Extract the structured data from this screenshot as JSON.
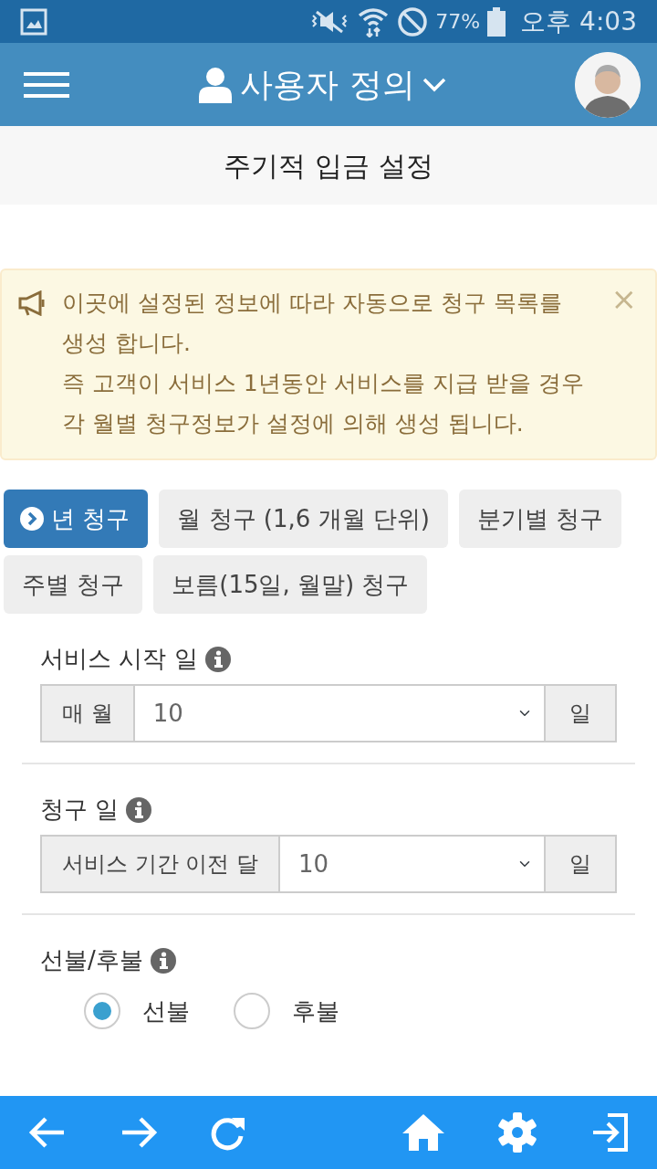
{
  "status_bar": {
    "battery": "77%",
    "time": "오후 4:03"
  },
  "header": {
    "title": "사용자 정의"
  },
  "page_title": "주기적 입금 설정",
  "alert": {
    "paragraphs": [
      "이곳에 설정된 정보에 따라 자동으로 청구 목록를 생성 합니다.",
      "즉 고객이 서비스 1년동안 서비스를 지급 받을 경우 각 월별 청구정보가 설정에 의해 생성 됩니다."
    ],
    "close": "×"
  },
  "tabs": [
    {
      "label": "년 청구",
      "selected": true
    },
    {
      "label": "월 청구 (1,6 개월 단위)",
      "selected": false
    },
    {
      "label": "분기별 청구",
      "selected": false
    },
    {
      "label": "주별 청구",
      "selected": false
    },
    {
      "label": "보름(15일, 월말) 청구",
      "selected": false
    }
  ],
  "fields": [
    {
      "kind": "select",
      "label": "서비스 시작 일",
      "prefix": "매 월",
      "value": "10",
      "suffix": "일"
    },
    {
      "kind": "select",
      "label": "청구 일",
      "prefix": "서비스 기간 이전 달",
      "value": "10",
      "suffix": "일"
    },
    {
      "kind": "radio",
      "label": "선불/후불",
      "options": [
        {
          "label": "선불",
          "selected": true
        },
        {
          "label": "후불",
          "selected": false
        }
      ]
    }
  ]
}
